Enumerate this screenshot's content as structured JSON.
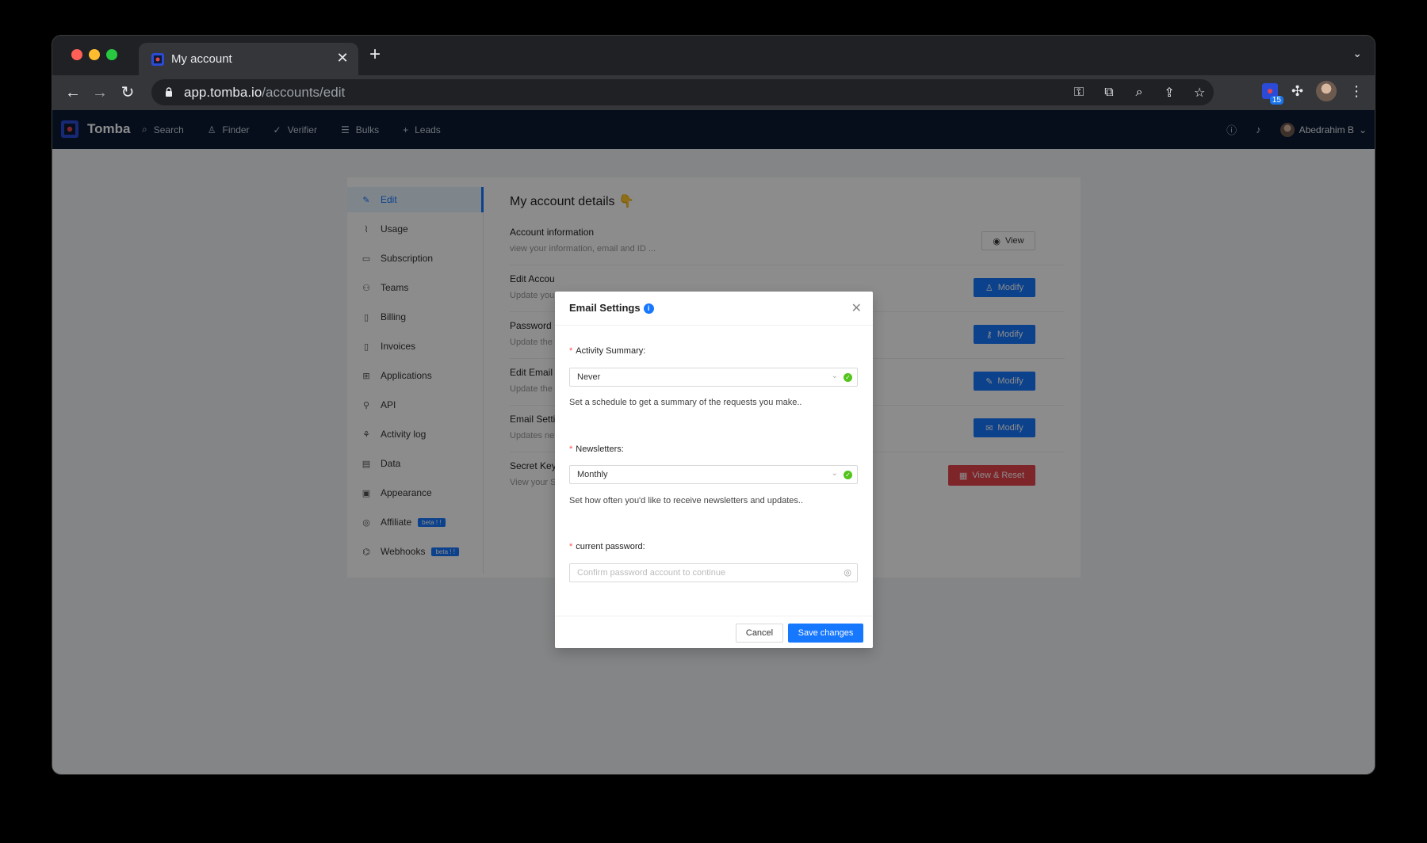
{
  "browser": {
    "tab_title": "My account",
    "tab_close": "✕",
    "new_tab": "+",
    "tab_list": "⌄",
    "url_host": "app.tomba.io",
    "url_path": "/accounts/edit",
    "extension_badge": "15"
  },
  "app": {
    "brand": "Tomba",
    "menu": [
      {
        "icon": "search-icon",
        "label": "Search"
      },
      {
        "icon": "user-icon",
        "label": "Finder"
      },
      {
        "icon": "check-icon",
        "label": "Verifier"
      },
      {
        "icon": "list-icon",
        "label": "Bulks"
      },
      {
        "icon": "plus-icon",
        "label": "Leads"
      }
    ],
    "user_name": "Abedrahim B"
  },
  "sidebar": {
    "items": [
      {
        "label": "Edit",
        "icon": "edit-icon",
        "active": true
      },
      {
        "label": "Usage",
        "icon": "chart-icon"
      },
      {
        "label": "Subscription",
        "icon": "card-icon"
      },
      {
        "label": "Teams",
        "icon": "team-icon"
      },
      {
        "label": "Billing",
        "icon": "file-icon"
      },
      {
        "label": "Invoices",
        "icon": "file-icon"
      },
      {
        "label": "Applications",
        "icon": "apps-icon"
      },
      {
        "label": "API",
        "icon": "api-icon"
      },
      {
        "label": "Activity log",
        "icon": "activity-icon"
      },
      {
        "label": "Data",
        "icon": "data-icon"
      },
      {
        "label": "Appearance",
        "icon": "appearance-icon"
      },
      {
        "label": "Affiliate",
        "icon": "affiliate-icon",
        "badge": "beta ! !"
      },
      {
        "label": "Webhooks",
        "icon": "webhook-icon",
        "badge": "beta ! !"
      }
    ]
  },
  "main": {
    "title": "My account details 👇",
    "rows": [
      {
        "title": "Account information",
        "desc": "view your information, email and ID ...",
        "button": "View"
      },
      {
        "title": "Edit Accou",
        "desc": "Update you",
        "button": "Modify"
      },
      {
        "title": "Password",
        "desc": "Update the",
        "button": "Modify"
      },
      {
        "title": "Edit Email",
        "desc": "Update the",
        "button": "Modify"
      },
      {
        "title": "Email Settin",
        "desc": "Updates ne",
        "button": "Modify"
      },
      {
        "title": "Secret Key",
        "desc": "View your S",
        "button": "View & Reset"
      }
    ]
  },
  "modal": {
    "title": "Email Settings",
    "info": "i",
    "close": "✕",
    "activity_label": "Activity Summary",
    "activity_value": "Never",
    "activity_help": "Set a schedule to get a summary of the requests you make..",
    "newsletters_label": "Newsletters",
    "newsletters_value": "Monthly",
    "newsletters_help": "Set how often you'd like to receive newsletters and updates..",
    "password_label": "current password",
    "password_placeholder": "Confirm password account to continue",
    "cancel": "Cancel",
    "save": "Save changes",
    "required_mark": "*",
    "colon": ":"
  },
  "colors": {
    "primary": "#1677ff",
    "danger": "#e5444b",
    "nav_bg": "#0c1a33"
  }
}
